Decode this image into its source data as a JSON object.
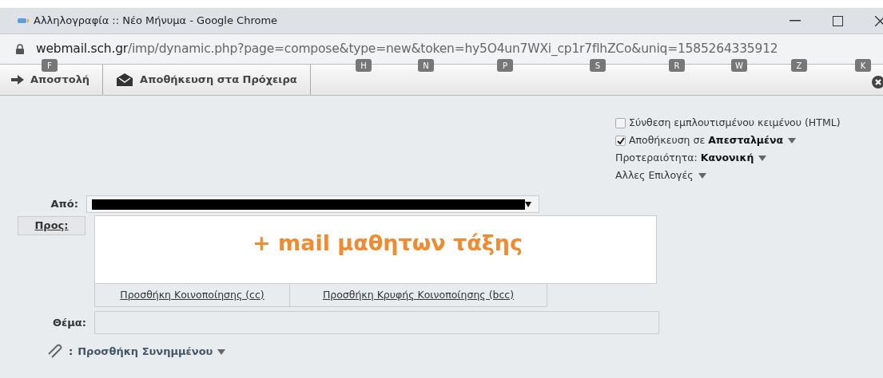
{
  "window": {
    "title": "Αλληλογραφία :: Νέο Μήνυμα - Google Chrome"
  },
  "address_bar": {
    "host": "webmail.sch.gr",
    "path": "/imp/dynamic.php?page=compose&type=new&token=hy5O4un7WXi_cp1r7flhZCo&uniq=1585264335912"
  },
  "toolbar": {
    "buttons": [
      {
        "kind": "send",
        "label": "Αποστολή"
      },
      {
        "kind": "draft",
        "label": "Αποθήκευση στα Πρόχειρα"
      }
    ],
    "shortcut_keys": [
      "F",
      "H",
      "N",
      "P",
      "S",
      "R",
      "W",
      "Z",
      "K"
    ]
  },
  "options": [
    {
      "kind": "checkbox",
      "label": "Σύνθεση εμπλουτισμένου κειμένου (HTML)",
      "checked": false
    },
    {
      "kind": "checkbox",
      "label": "Αποθήκευση σε",
      "value": "Απεσταλμένα",
      "checked": true,
      "dropdown": true
    },
    {
      "kind": "text",
      "label": "Προτεραιότητα:",
      "value": "Κανονική",
      "dropdown": true
    },
    {
      "kind": "text",
      "label": "Αλλες Επιλογές",
      "dropdown": true
    }
  ],
  "form": {
    "from_label": "Από:",
    "to_button": "Προς:",
    "to_note": "+ mail μαθητων τάξης",
    "cc_link": "Προσθήκη Κοινοποίησης (cc)",
    "bcc_link": "Προσθήκη Κρυφής Κοινοποίησης (bcc)",
    "subject_label": "Θέμα:",
    "attach_link": "Προσθήκη Συνημμένου",
    "attach_sep": ":"
  }
}
